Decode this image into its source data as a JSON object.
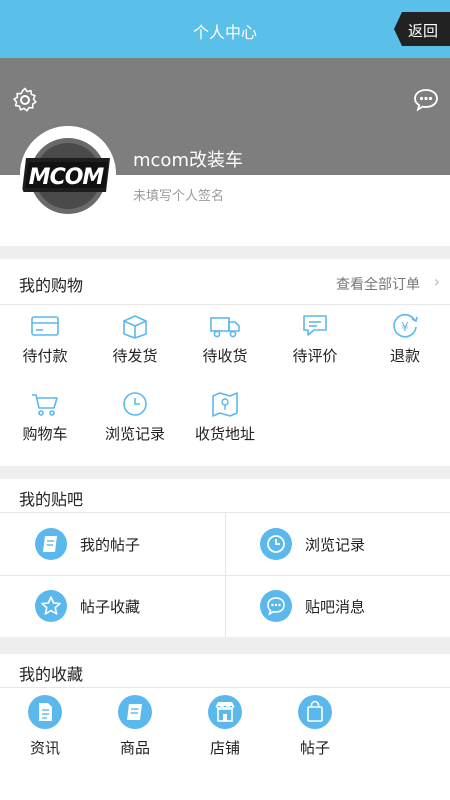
{
  "nav": {
    "title": "个人中心",
    "back_label": "返回"
  },
  "profile": {
    "username": "mcom改装车",
    "signature": "未填写个人签名"
  },
  "shopping": {
    "title": "我的购物",
    "more": "查看全部订单",
    "items": [
      {
        "label": "待付款",
        "icon": "card-icon"
      },
      {
        "label": "待发货",
        "icon": "package-icon"
      },
      {
        "label": "待收货",
        "icon": "truck-icon"
      },
      {
        "label": "待评价",
        "icon": "chat-icon"
      },
      {
        "label": "退款",
        "icon": "refund-icon"
      },
      {
        "label": "购物车",
        "icon": "cart-icon"
      },
      {
        "label": "浏览记录",
        "icon": "clock-icon"
      },
      {
        "label": "收货地址",
        "icon": "map-icon"
      }
    ]
  },
  "tieba": {
    "title": "我的贴吧",
    "items": [
      {
        "label": "我的帖子",
        "icon": "post-icon"
      },
      {
        "label": "浏览记录",
        "icon": "clock-icon"
      },
      {
        "label": "帖子收藏",
        "icon": "star-icon"
      },
      {
        "label": "贴吧消息",
        "icon": "message-icon"
      }
    ]
  },
  "favorites": {
    "title": "我的收藏",
    "items": [
      {
        "label": "资讯",
        "icon": "news-icon"
      },
      {
        "label": "商品",
        "icon": "goods-icon"
      },
      {
        "label": "店铺",
        "icon": "store-icon"
      },
      {
        "label": "帖子",
        "icon": "bag-icon"
      }
    ]
  },
  "colors": {
    "accent": "#5ac0ea",
    "icon_blue": "#5bb8ec",
    "band_gray": "#7e7e7e"
  }
}
